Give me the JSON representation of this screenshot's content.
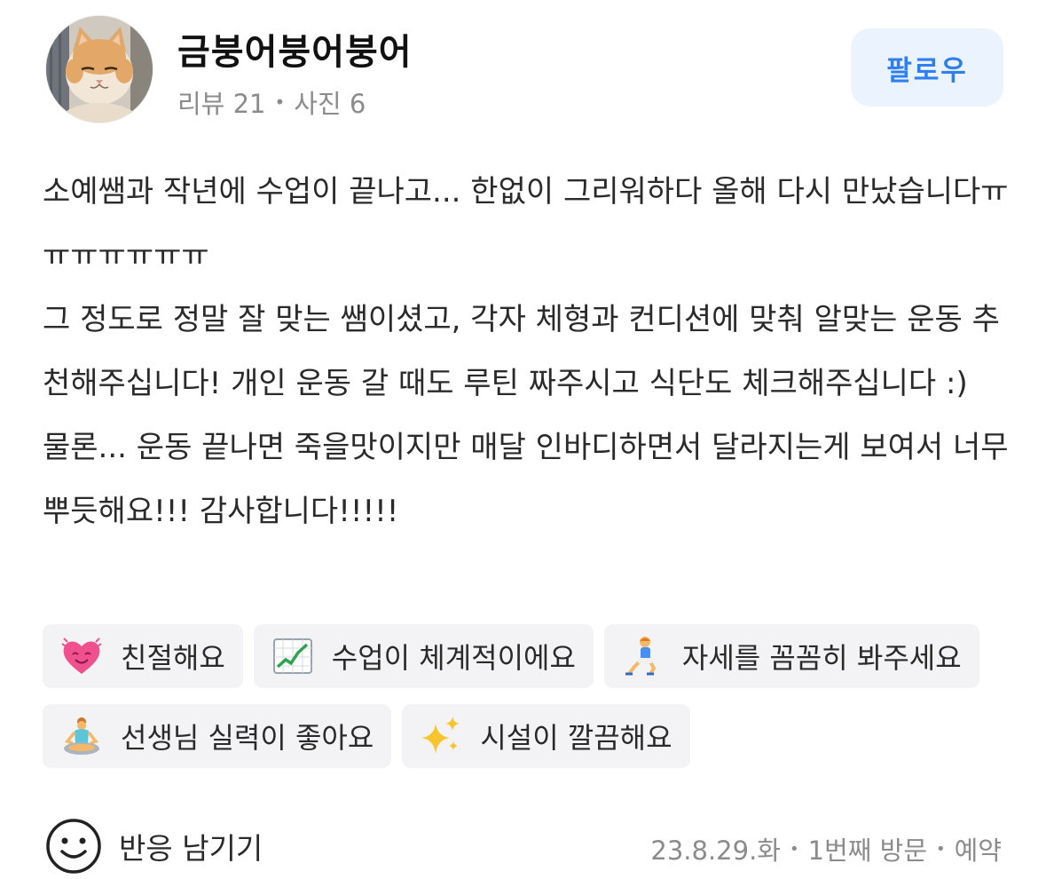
{
  "profile": {
    "username": "금붕어붕어붕어",
    "review_count": "리뷰 21",
    "photo_count": "사진 6",
    "follow_label": "팔로우",
    "avatar_icon": "cat-avatar-icon"
  },
  "review": {
    "paragraphs": [
      "소예쌤과 작년에 수업이 끝나고... 한없이 그리워하다 올해 다시 만났습니다ㅠㅠㅠㅠㅠㅠㅠ",
      "그 정도로 정말 잘 맞는 쌤이셨고, 각자 체형과 컨디션에 맞춰 알맞는 운동 추천해주십니다! 개인 운동 갈 때도 루틴 짜주시고 식단도 체크해주십니다 :)",
      "물론... 운동 끝나면 죽을맛이지만 매달 인바디하면서 달라지는게 보여서 너무 뿌듯해요!!! 감사합니다!!!!!"
    ]
  },
  "tags": [
    {
      "label": "친절해요",
      "icon": "smiling-heart-icon"
    },
    {
      "label": "수업이 체계적이에요",
      "icon": "chart-increasing-icon"
    },
    {
      "label": "자세를 꼼꼼히 봐주세요",
      "icon": "lunging-person-icon"
    },
    {
      "label": "선생님 실력이 좋아요",
      "icon": "lotus-position-icon"
    },
    {
      "label": "시설이 깔끔해요",
      "icon": "sparkles-icon"
    }
  ],
  "footer": {
    "react_label": "반응 남기기",
    "date": "23.8.29.화",
    "visit": "1번째 방문",
    "type": "예약"
  },
  "colors": {
    "accent": "#2f7ff0",
    "follow_bg": "#eaf3fe",
    "tag_bg": "#f3f3f5",
    "muted_text": "#8b8b8b"
  }
}
